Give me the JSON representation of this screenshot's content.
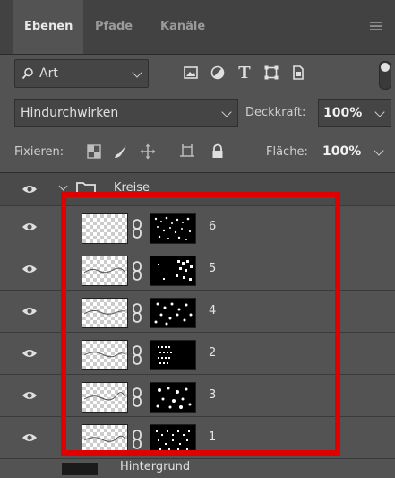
{
  "tabs": [
    {
      "label": "Ebenen",
      "active": true
    },
    {
      "label": "Pfade",
      "active": false
    },
    {
      "label": "Kanäle",
      "active": false
    }
  ],
  "filter": {
    "kind_label": "Art",
    "icons": [
      "image-filter-icon",
      "adjustment-filter-icon",
      "text-filter-icon",
      "shape-filter-icon",
      "smart-object-filter-icon"
    ]
  },
  "blend": {
    "mode": "Hindurchwirken",
    "opacity_label": "Deckkraft:",
    "opacity_value": "100%"
  },
  "lock": {
    "label": "Fixieren:",
    "fill_label": "Fläche:",
    "fill_value": "100%"
  },
  "group": {
    "name": "Kreise"
  },
  "layers": [
    {
      "name": "6"
    },
    {
      "name": "5"
    },
    {
      "name": "4"
    },
    {
      "name": "2"
    },
    {
      "name": "3"
    },
    {
      "name": "1"
    }
  ],
  "bottom_layer": {
    "name": "Hintergrund"
  },
  "colors": {
    "panel_bg": "#535353",
    "tab_bar": "#424242",
    "highlight": "#e00000"
  }
}
